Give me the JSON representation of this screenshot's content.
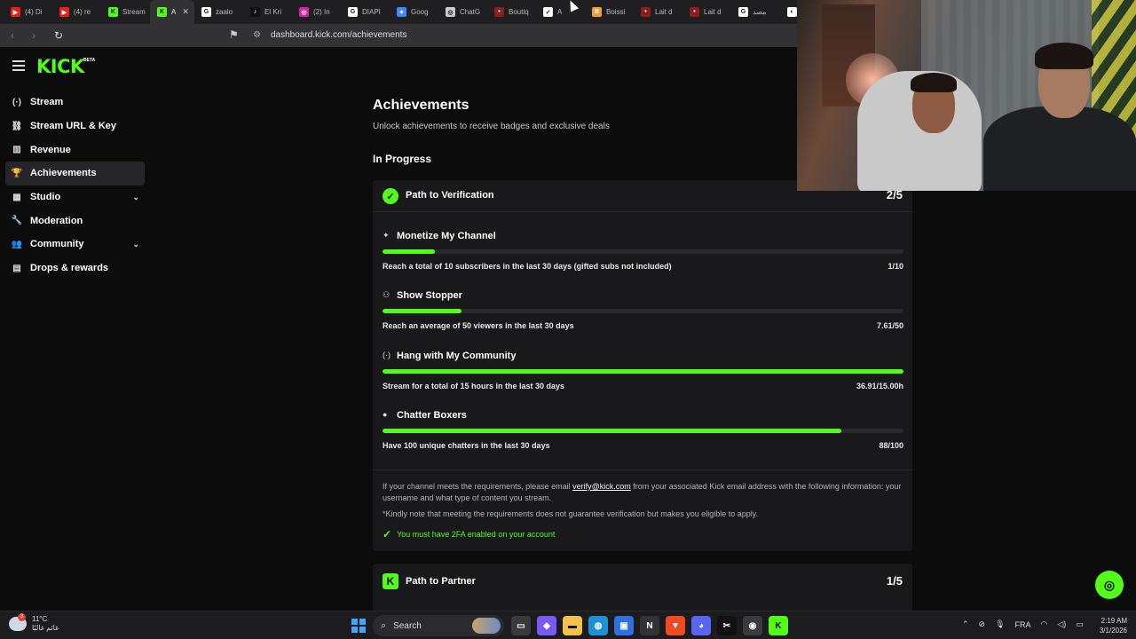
{
  "browser": {
    "tabs": [
      {
        "label": "(4) Di",
        "color": "#e62117",
        "glyph": "▶"
      },
      {
        "label": "(4) re",
        "color": "#e62117",
        "glyph": "▶"
      },
      {
        "label": "Stream",
        "color": "#53fc18",
        "glyph": "K"
      },
      {
        "label": "A",
        "color": "#53fc18",
        "glyph": "K",
        "active": true
      },
      {
        "label": "zaalo",
        "color": "#ffffff",
        "glyph": "G"
      },
      {
        "label": "El Kri",
        "color": "#111111",
        "glyph": "♪"
      },
      {
        "label": "(2) In",
        "color": "#d6249f",
        "glyph": "◎"
      },
      {
        "label": "DIAPI",
        "color": "#ffffff",
        "glyph": "G"
      },
      {
        "label": "Goog",
        "color": "#4285f4",
        "glyph": "✦"
      },
      {
        "label": "ChatG",
        "color": "#cccccc",
        "glyph": "◎"
      },
      {
        "label": "Boutiq",
        "color": "#8b1e1e",
        "glyph": "•"
      },
      {
        "label": "A",
        "color": "#ffffff",
        "glyph": "✓"
      },
      {
        "label": "Boissi",
        "color": "#f0a030",
        "glyph": "B"
      },
      {
        "label": "Lait d",
        "color": "#8b1e1e",
        "glyph": "•"
      },
      {
        "label": "Lait d",
        "color": "#8b1e1e",
        "glyph": "•"
      },
      {
        "label": "مصد",
        "color": "#ffffff",
        "glyph": "G"
      },
      {
        "label": "",
        "color": "#ffffff",
        "glyph": "◐"
      }
    ],
    "url": "dashboard.kick.com/achievements"
  },
  "sidebar": {
    "logo": "KICK",
    "logo_badge": "BETA",
    "items": [
      {
        "label": "Stream",
        "icon": "broadcast-icon",
        "glyph": "(·)"
      },
      {
        "label": "Stream URL & Key",
        "icon": "link-icon",
        "glyph": "⛓"
      },
      {
        "label": "Revenue",
        "icon": "chart-icon",
        "glyph": "▥"
      },
      {
        "label": "Achievements",
        "icon": "trophy-icon",
        "glyph": "🏆",
        "active": true
      },
      {
        "label": "Studio",
        "icon": "studio-icon",
        "glyph": "▦",
        "expandable": true
      },
      {
        "label": "Moderation",
        "icon": "wrench-icon",
        "glyph": "🔧"
      },
      {
        "label": "Community",
        "icon": "community-icon",
        "glyph": "👥",
        "expandable": true
      },
      {
        "label": "Drops & rewards",
        "icon": "drops-icon",
        "glyph": "▤"
      }
    ]
  },
  "main": {
    "title": "Achievements",
    "subtitle": "Unlock achievements to receive badges and exclusive deals",
    "section": "In Progress",
    "card": {
      "title": "Path to Verification",
      "count": "2/5",
      "achievements": [
        {
          "name": "Monetize My Channel",
          "icon": "sparkle-icon",
          "glyph": "✦",
          "desc": "Reach a total of 10 subscribers in the last 30 days (gifted subs not included)",
          "value": "1/10",
          "progress": 0.1
        },
        {
          "name": "Show Stopper",
          "icon": "viewers-icon",
          "glyph": "⚇",
          "desc": "Reach an average of 50 viewers in the last 30 days",
          "value": "7.61/50",
          "progress": 0.152
        },
        {
          "name": "Hang with My Community",
          "icon": "broadcast-icon",
          "glyph": "(·)",
          "desc": "Stream for a total of 15 hours in the last 30 days",
          "value": "36.91/15.00h",
          "progress": 1.0
        },
        {
          "name": "Chatter Boxers",
          "icon": "chat-icon",
          "glyph": "●",
          "desc": "Have 100 unique chatters in the last 30 days",
          "value": "88/100",
          "progress": 0.88
        }
      ],
      "note_prefix": "If your channel meets the requirements, please email ",
      "note_email": "verify@kick.com",
      "note_suffix": " from your associated Kick email address with the following information: your username and what type of content you stream.",
      "note2": "*Kindly note that meeting the requirements does not guarantee verification but makes you eligible to apply.",
      "requirement": "You must have 2FA enabled on your account"
    },
    "card2": {
      "title": "Path to Partner",
      "count": "1/5"
    }
  },
  "taskbar": {
    "weather_temp": "11°C",
    "weather_desc": "غائم غالبًا",
    "weather_badge": "3",
    "search_label": "Search",
    "apps": [
      {
        "name": "file-explorer-icon",
        "color": "#3a3a3d",
        "glyph": "▭"
      },
      {
        "name": "copilot-icon",
        "color": "#7a5af5",
        "glyph": "◆"
      },
      {
        "name": "folder-icon",
        "color": "#f2c14e",
        "glyph": "▬"
      },
      {
        "name": "edge-icon",
        "color": "#1e90d6",
        "glyph": "◍"
      },
      {
        "name": "store-icon",
        "color": "#2f6fde",
        "glyph": "▣"
      },
      {
        "name": "notion-icon",
        "color": "#333336",
        "glyph": "N"
      },
      {
        "name": "brave-icon",
        "color": "#f04a23",
        "glyph": "▼"
      },
      {
        "name": "discord-icon",
        "color": "#5865f2",
        "glyph": "◕"
      },
      {
        "name": "capcut-icon",
        "color": "#111111",
        "glyph": "✂"
      },
      {
        "name": "chrome-icon",
        "color": "#3b3b3e",
        "glyph": "◉"
      },
      {
        "name": "kick-app-icon",
        "color": "#53fc18",
        "glyph": "K"
      }
    ],
    "tray_lang": "FRA",
    "time": "2:19 AM",
    "date": "3/1/2026"
  }
}
